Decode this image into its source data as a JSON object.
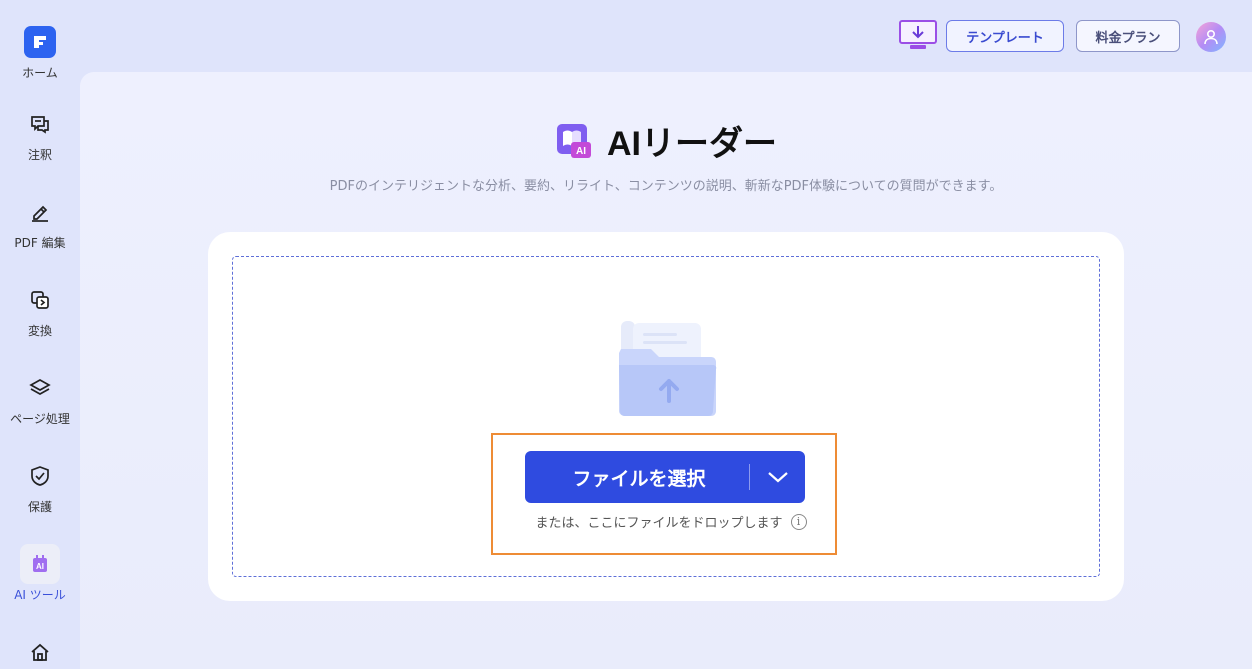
{
  "sidebar": {
    "items": [
      {
        "label": "ホーム",
        "icon": "home-logo-icon"
      },
      {
        "label": "注釈",
        "icon": "annotate-icon"
      },
      {
        "label": "PDF 編集",
        "icon": "edit-pen-icon"
      },
      {
        "label": "変換",
        "icon": "convert-icon"
      },
      {
        "label": "ページ処理",
        "icon": "layers-icon"
      },
      {
        "label": "保護",
        "icon": "shield-check-icon"
      },
      {
        "label": "AI ツール",
        "icon": "ai-tool-icon",
        "active": true
      },
      {
        "label": "",
        "icon": "house-icon"
      }
    ]
  },
  "topbar": {
    "template_label": "テンプレート",
    "pricing_label": "料金プラン"
  },
  "main": {
    "title": "AIリーダー",
    "title_icon_text": "AI",
    "subtitle": "PDFのインテリジェントな分析、要約、リライト、コンテンツの説明、斬新なPDF体験についての質問ができます。",
    "select_button_label": "ファイルを選択",
    "drop_hint": "または、ここにファイルをドロップします",
    "info_glyph": "i"
  },
  "colors": {
    "accent": "#2f4be0",
    "highlight": "#ee8c35",
    "active_label": "#3a50d9"
  }
}
